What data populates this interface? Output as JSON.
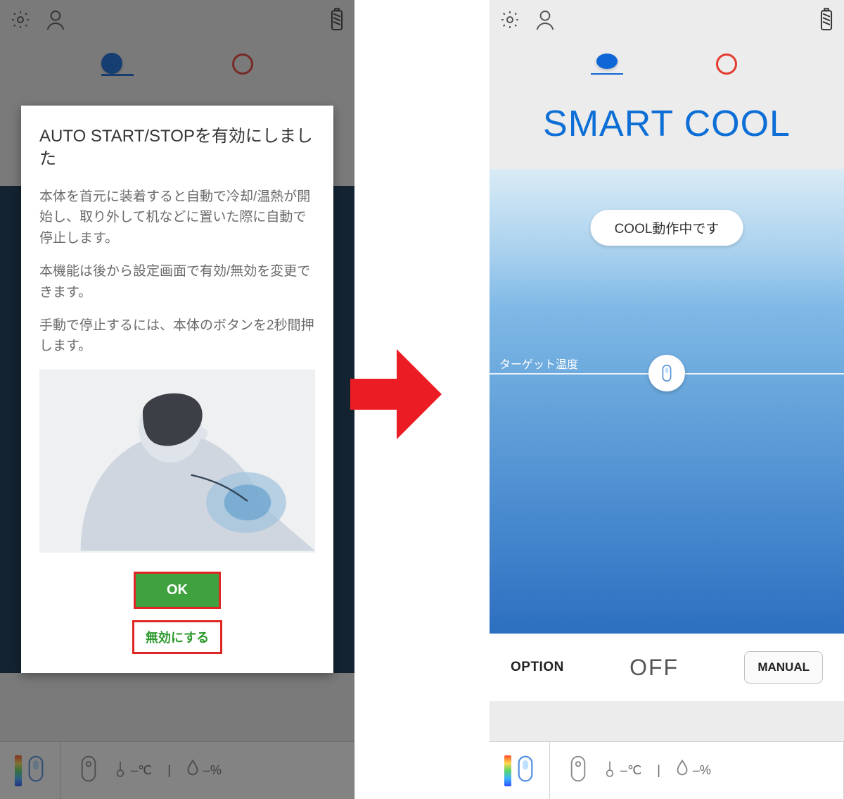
{
  "left": {
    "dialog": {
      "title": "AUTO START/STOPを有効にしました",
      "p1": "本体を首元に装着すると自動で冷却/温熱が開始し、取り外して机などに置いた際に自動で停止します。",
      "p2": "本機能は後から設定画面で有効/無効を変更できます。",
      "p3": "手動で停止するには、本体のボタンを2秒間押します。",
      "ok": "OK",
      "disable": "無効にする"
    },
    "footer": {
      "temp": "–℃",
      "humid": "–%"
    }
  },
  "right": {
    "title": "SMART COOL",
    "status_pill": "COOL動作中です",
    "target_label": "ターゲット温度",
    "option": "OPTION",
    "off": "OFF",
    "manual": "MANUAL",
    "footer": {
      "temp": "–℃",
      "humid": "–%"
    }
  }
}
